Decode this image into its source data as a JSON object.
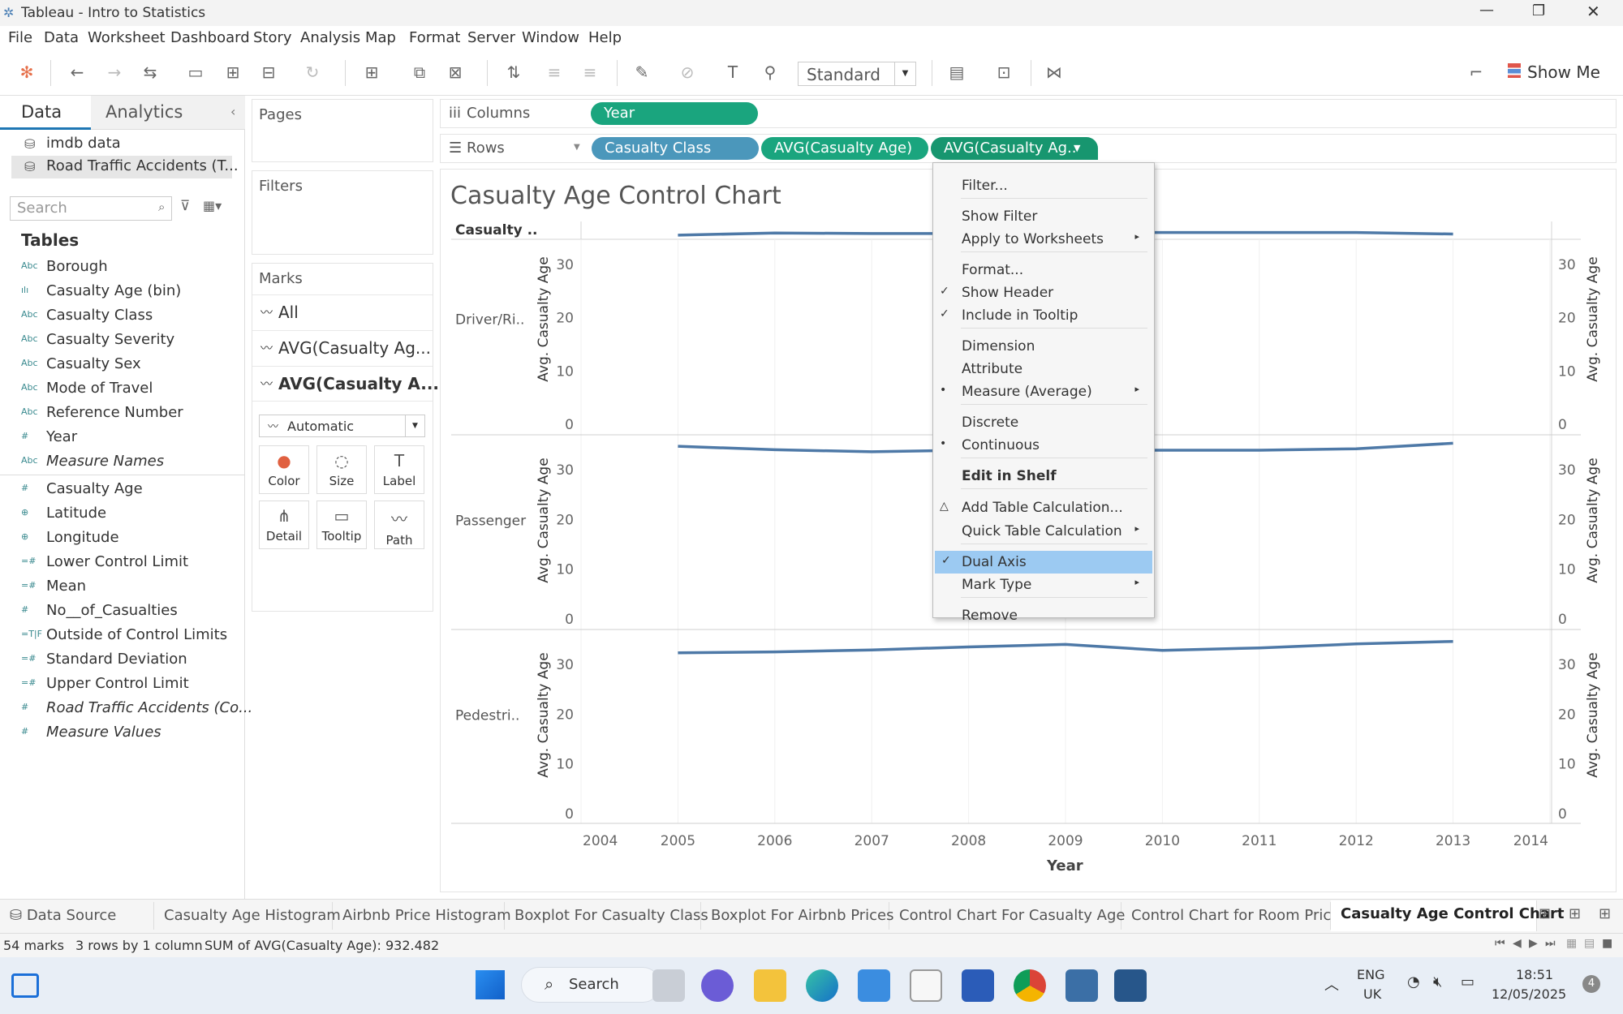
{
  "window": {
    "title": "Tableau - Intro to Statistics"
  },
  "menu": [
    "File",
    "Data",
    "Worksheet",
    "Dashboard",
    "Story",
    "Analysis",
    "Map",
    "Format",
    "Server",
    "Window",
    "Help"
  ],
  "toolbar": {
    "fit_value": "Standard",
    "show_me": "Show Me"
  },
  "data_pane": {
    "tab_data": "Data",
    "tab_analytics": "Analytics",
    "sources": [
      "imdb data",
      "Road Traffic Accidents (T..."
    ],
    "search_placeholder": "Search",
    "tables_header": "Tables",
    "fields": [
      {
        "icon": "Abc",
        "name": "Borough"
      },
      {
        "icon": "ılı",
        "name": "Casualty Age (bin)"
      },
      {
        "icon": "Abc",
        "name": "Casualty Class"
      },
      {
        "icon": "Abc",
        "name": "Casualty Severity"
      },
      {
        "icon": "Abc",
        "name": "Casualty Sex"
      },
      {
        "icon": "Abc",
        "name": "Mode of Travel"
      },
      {
        "icon": "Abc",
        "name": "Reference Number"
      },
      {
        "icon": "#",
        "name": "Year"
      },
      {
        "icon": "Abc",
        "name": "Measure Names"
      }
    ],
    "measures": [
      {
        "icon": "#",
        "name": "Casualty Age"
      },
      {
        "icon": "⊕",
        "name": "Latitude"
      },
      {
        "icon": "⊕",
        "name": "Longitude"
      },
      {
        "icon": "=#",
        "name": "Lower Control Limit"
      },
      {
        "icon": "=#",
        "name": "Mean"
      },
      {
        "icon": "#",
        "name": "No__of_Casualties"
      },
      {
        "icon": "=T|F",
        "name": "Outside of Control Limits"
      },
      {
        "icon": "=#",
        "name": "Standard Deviation"
      },
      {
        "icon": "=#",
        "name": "Upper Control Limit"
      },
      {
        "icon": "#",
        "name": "Road Traffic Accidents (Co..."
      },
      {
        "icon": "#",
        "name": "Measure Values"
      }
    ]
  },
  "cards": {
    "pages": "Pages",
    "filters": "Filters",
    "marks": "Marks",
    "marks_all": "All",
    "marks_layer1": "AVG(Casualty Ag...",
    "marks_layer2": "AVG(Casualty A...",
    "mark_type": "Automatic",
    "mark_buttons": [
      "Color",
      "Size",
      "Label",
      "Detail",
      "Tooltip",
      "Path"
    ]
  },
  "shelves": {
    "columns_label": "Columns",
    "rows_label": "Rows",
    "columns_pills": [
      "Year"
    ],
    "rows_pills": [
      "Casualty Class",
      "AVG(Casualty Age)",
      "AVG(Casualty Ag.."
    ]
  },
  "context_menu": {
    "items": [
      {
        "label": "Filter...",
        "check": "",
        "arrow": false
      },
      {
        "label": "Show Filter",
        "check": "",
        "arrow": false
      },
      {
        "label": "Apply to Worksheets",
        "check": "",
        "arrow": true
      },
      {
        "label": "Format...",
        "check": "",
        "arrow": false
      },
      {
        "label": "Show Header",
        "check": "✓",
        "arrow": false
      },
      {
        "label": "Include in Tooltip",
        "check": "✓",
        "arrow": false
      },
      {
        "label": "Dimension",
        "check": "",
        "arrow": false
      },
      {
        "label": "Attribute",
        "check": "",
        "arrow": false
      },
      {
        "label": "Measure (Average)",
        "check": "•",
        "arrow": true
      },
      {
        "label": "Discrete",
        "check": "",
        "arrow": false
      },
      {
        "label": "Continuous",
        "check": "•",
        "arrow": false
      },
      {
        "label": "Edit in Shelf",
        "check": "",
        "arrow": false
      },
      {
        "label": "Add Table Calculation...",
        "check": "△",
        "arrow": false
      },
      {
        "label": "Quick Table Calculation",
        "check": "",
        "arrow": true
      },
      {
        "label": "Dual Axis",
        "check": "✓",
        "arrow": false
      },
      {
        "label": "Mark Type",
        "check": "",
        "arrow": true
      },
      {
        "label": "Remove",
        "check": "",
        "arrow": false
      }
    ]
  },
  "chart": {
    "title": "Casualty Age Control Chart",
    "row_header": "Casualty ..",
    "rows": [
      "Driver/Ri..",
      "Passenger",
      "Pedestri.."
    ],
    "y_axis_label": "Avg. Casualty Age",
    "y_ticks": [
      "0",
      "10",
      "20",
      "30"
    ],
    "x_axis_label": "Year",
    "x_ticks": [
      "2004",
      "2005",
      "2006",
      "2007",
      "2008",
      "2009",
      "2010",
      "2011",
      "2012",
      "2013",
      "2014"
    ]
  },
  "chart_data": {
    "type": "line",
    "title": "Casualty Age Control Chart",
    "xlabel": "Year",
    "ylabel": "Avg. Casualty Age",
    "ylim": [
      0,
      37
    ],
    "xlim": [
      2004,
      2014
    ],
    "x": [
      2005,
      2006,
      2007,
      2008,
      2009,
      2010,
      2011,
      2012,
      2013
    ],
    "panels": [
      {
        "name": "Driver/Ri..",
        "values": [
          35.5,
          35.9,
          35.8,
          35.8,
          36.0,
          36.0,
          36.0,
          36.0,
          35.7
        ]
      },
      {
        "name": "Passenger",
        "values": [
          34.7,
          34.0,
          33.6,
          33.9,
          33.9,
          33.9,
          33.9,
          34.2,
          35.3
        ]
      },
      {
        "name": "Pedestri..",
        "values": [
          32.3,
          32.5,
          32.9,
          33.5,
          34.0,
          32.8,
          33.3,
          34.1,
          34.6
        ]
      }
    ],
    "line_color": "#4e79a7",
    "grid": false
  },
  "sheet_tabs": [
    "Data Source",
    "Casualty Age Histogram",
    "Airbnb Price Histogram",
    "Boxplot For Casualty Class",
    "Boxplot For Airbnb Prices",
    "Control Chart For Casualty Age",
    "Control Chart for Room Price",
    "Casualty Age Control Chart"
  ],
  "status": {
    "marks": "54 marks",
    "dims": "3 rows by 1 column",
    "sum": "SUM of AVG(Casualty Age): 932.482"
  },
  "taskbar": {
    "search": "Search",
    "lang1": "ENG",
    "lang2": "UK",
    "time": "18:51",
    "date": "12/05/2025",
    "badge": "4"
  },
  "colors": {
    "pill_blue": "#4b97bb",
    "pill_green": "#1aa57e",
    "highlight": "#9ccaf2",
    "line": "#4e79a7"
  }
}
